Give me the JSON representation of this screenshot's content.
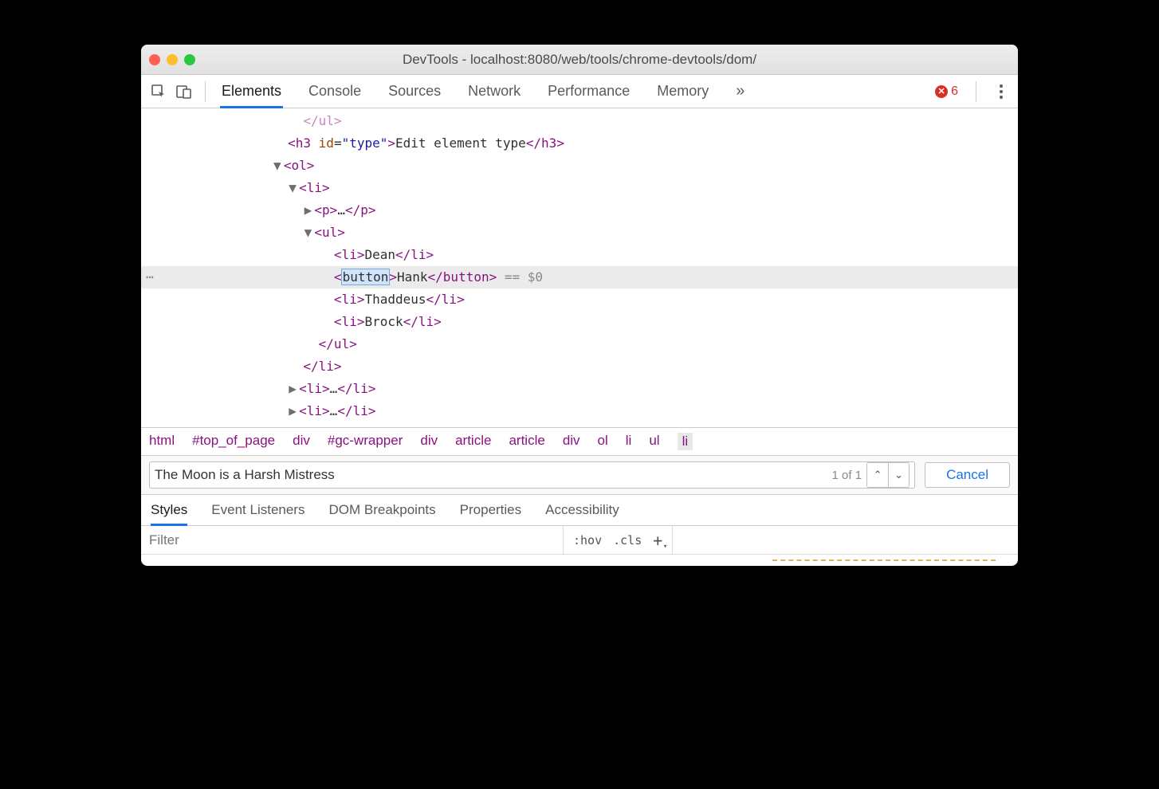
{
  "window": {
    "title": "DevTools - localhost:8080/web/tools/chrome-devtools/dom/"
  },
  "toolbar": {
    "tabs": [
      "Elements",
      "Console",
      "Sources",
      "Network",
      "Performance",
      "Memory"
    ],
    "overflow": "»",
    "error_count": "6"
  },
  "dom": {
    "line1": "</ul>",
    "h3_attr_name": "id",
    "h3_attr_val": "\"type\"",
    "h3_text": "Edit element type",
    "ol": "ol",
    "li": "li",
    "p": "p",
    "ul": "ul",
    "items": [
      "Dean",
      "Hank",
      "Thaddeus",
      "Brock"
    ],
    "edit_tag": "button",
    "sel_tail": " == $0",
    "ellipsis": "…"
  },
  "breadcrumb": [
    "html",
    "#top_of_page",
    "div",
    "#gc-wrapper",
    "div",
    "article",
    "article",
    "div",
    "ol",
    "li",
    "ul",
    "li"
  ],
  "search": {
    "value": "The Moon is a Harsh Mistress",
    "matches": "1 of 1",
    "cancel": "Cancel"
  },
  "subtabs": [
    "Styles",
    "Event Listeners",
    "DOM Breakpoints",
    "Properties",
    "Accessibility"
  ],
  "filter": {
    "placeholder": "Filter",
    "hov": ":hov",
    "cls": ".cls"
  }
}
